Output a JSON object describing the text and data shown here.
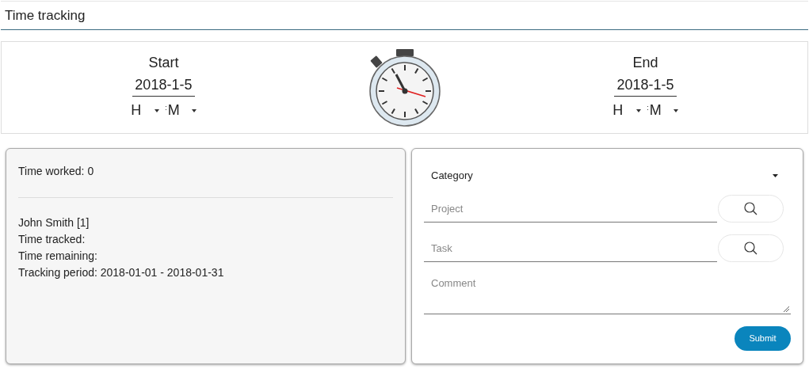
{
  "header": {
    "title": "Time tracking"
  },
  "start": {
    "label": "Start",
    "date": "2018-1-5",
    "hour": "H",
    "separator": ":",
    "minute": "M"
  },
  "end": {
    "label": "End",
    "date": "2018-1-5",
    "hour": "H",
    "separator": ":",
    "minute": "M"
  },
  "summary": {
    "time_worked": "Time worked: 0",
    "lines": [
      "John Smith [1]",
      "Time tracked:",
      "Time remaining:",
      "Tracking period: 2018-01-01 - 2018-01-31"
    ]
  },
  "form": {
    "category": "Category",
    "project": {
      "placeholder": "Project"
    },
    "task": {
      "placeholder": "Task"
    },
    "comment": {
      "placeholder": "Comment"
    },
    "submit": "Submit"
  }
}
